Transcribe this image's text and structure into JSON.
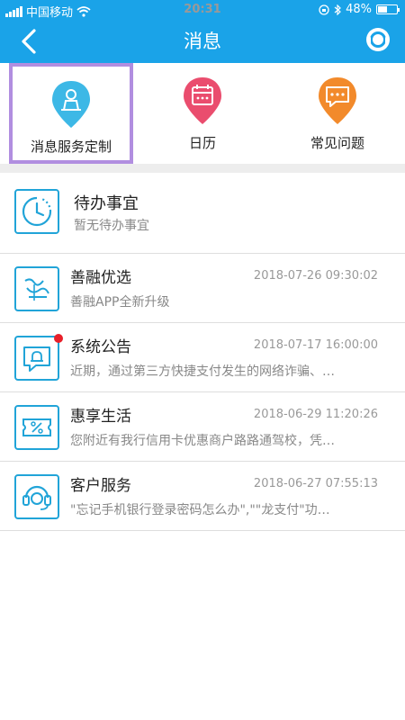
{
  "status_bar": {
    "carrier": "中国移动",
    "time": "20:31",
    "battery": "48%",
    "battery_level": 0.48
  },
  "nav": {
    "title": "消息"
  },
  "shortcuts": [
    {
      "label": "消息服务定制",
      "icon": "person-pin-icon",
      "color": "#3db8e6",
      "selected": true
    },
    {
      "label": "日历",
      "icon": "calendar-pin-icon",
      "color": "#ea4d6e",
      "selected": false
    },
    {
      "label": "常见问题",
      "icon": "chat-pin-icon",
      "color": "#f28a2b",
      "selected": false
    }
  ],
  "messages": [
    {
      "title": "待办事宜",
      "subtitle": "暂无待办事宜",
      "time": "",
      "icon": "clock-icon",
      "unread": false
    },
    {
      "title": "善融优选",
      "subtitle": "善融APP全新升级",
      "time": "2018-07-26 09:30:02",
      "icon": "shanrong-logo-icon",
      "unread": false
    },
    {
      "title": "系统公告",
      "subtitle": "近期，通过第三方快捷支付发生的网络诈骗、…",
      "time": "2018-07-17 16:00:00",
      "icon": "announcement-icon",
      "unread": true
    },
    {
      "title": "惠享生活",
      "subtitle": "您附近有我行信用卡优惠商户路路通驾校，凭…",
      "time": "2018-06-29 11:20:26",
      "icon": "coupon-icon",
      "unread": false
    },
    {
      "title": "客户服务",
      "subtitle": "\"忘记手机银行登录密码怎么办\",\"\"龙支付\"功…",
      "time": "2018-06-27 07:55:13",
      "icon": "headset-icon",
      "unread": false
    }
  ],
  "colors": {
    "brand": "#1aa3e8",
    "selection_border": "#b18ee0",
    "unread_dot": "#e8202a"
  }
}
